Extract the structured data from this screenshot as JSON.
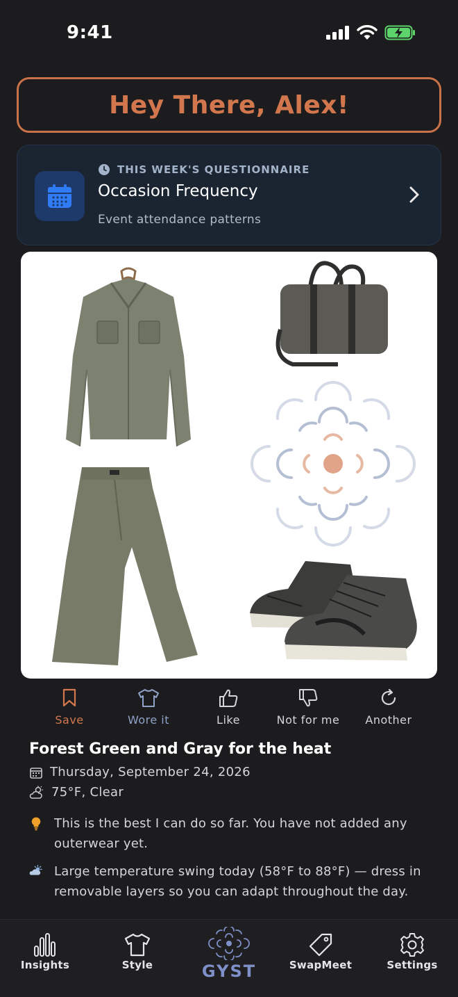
{
  "status_bar": {
    "time": "9:41"
  },
  "greeting": {
    "text": "Hey There, Alex!"
  },
  "questionnaire": {
    "eyebrow": "THIS WEEK'S QUESTIONNAIRE",
    "title": "Occasion Frequency",
    "subtitle": "Event attendance patterns"
  },
  "outfit_items": [
    "shirt",
    "laptop-bag",
    "pants",
    "high-top-sneakers"
  ],
  "actions": [
    {
      "label": "Save",
      "icon": "bookmark-icon",
      "color": "#d2774d"
    },
    {
      "label": "Wore it",
      "icon": "tshirt-icon",
      "color": "#8fa2c8"
    },
    {
      "label": "Like",
      "icon": "thumbs-up-icon",
      "color": "#d6d6d8"
    },
    {
      "label": "Not for me",
      "icon": "thumbs-down-icon",
      "color": "#d6d6d8"
    },
    {
      "label": "Another",
      "icon": "refresh-icon",
      "color": "#d6d6d8"
    }
  ],
  "outfit": {
    "title": "Forest Green and Gray for the heat",
    "date": "Thursday, September 24, 2026",
    "weather": "75°F, Clear"
  },
  "tips": [
    {
      "icon": "lightbulb-icon",
      "text": "This is the best I can do so far. You have not added any outerwear yet."
    },
    {
      "icon": "cloud-sun-icon",
      "text": "Large temperature swing today (58°F to 88°F) — dress in removable layers so you can adapt throughout the day."
    }
  ],
  "nav": [
    {
      "label": "Insights",
      "icon": "bar-chart-icon"
    },
    {
      "label": "Style",
      "icon": "tshirt-icon"
    },
    {
      "label": "GYST",
      "icon": "gyst-logo-icon"
    },
    {
      "label": "SwapMeet",
      "icon": "tag-icon"
    },
    {
      "label": "Settings",
      "icon": "gear-icon"
    }
  ],
  "colors": {
    "accent": "#d2774d",
    "background": "#1c1c1e",
    "card": "#1b2532",
    "gyst": "#7f90c8"
  }
}
